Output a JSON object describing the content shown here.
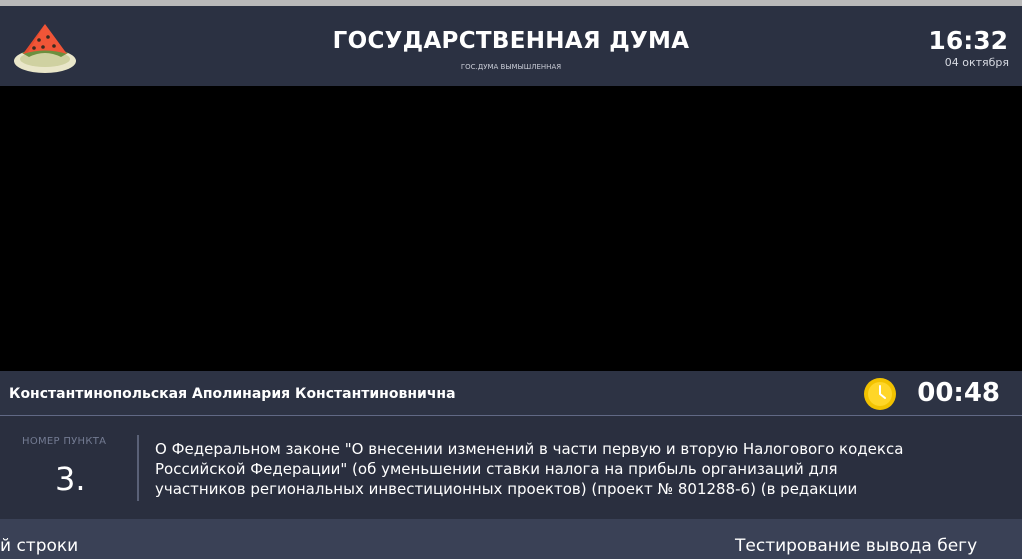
{
  "header": {
    "title": "ГОСУДАРСТВЕННАЯ ДУМА",
    "subtitle": "ГОС.ДУМА ВЫМЫШЛЕННАЯ",
    "time": "16:32",
    "date": "04 октября",
    "logo_icon": "watermelon-plate-icon"
  },
  "speaker": {
    "name": "Константинопольская Аполинария Константиновнична",
    "timer": "00:48",
    "timer_icon": "clock-icon"
  },
  "agenda": {
    "item_label": "НОМЕР ПУНКТА",
    "item_number": "3.",
    "item_text": "О Федеральном законе \"О внесении изменений в части первую и вторую Налогового кодекса\nРоссийской Федерации\" (об уменьшении ставки налога на прибыль организаций для\nучастников региональных инвестиционных проектов) (проект № 801288-6) (в редакции"
  },
  "ticker": {
    "left_fragment": "й строки",
    "right_fragment": "Тестирование вывода бегу"
  },
  "colors": {
    "background": "#2a2f3f",
    "header": "#2b3142",
    "video": "#000000",
    "ticker": "#3a4156",
    "clock_accent": "#f2c200"
  }
}
